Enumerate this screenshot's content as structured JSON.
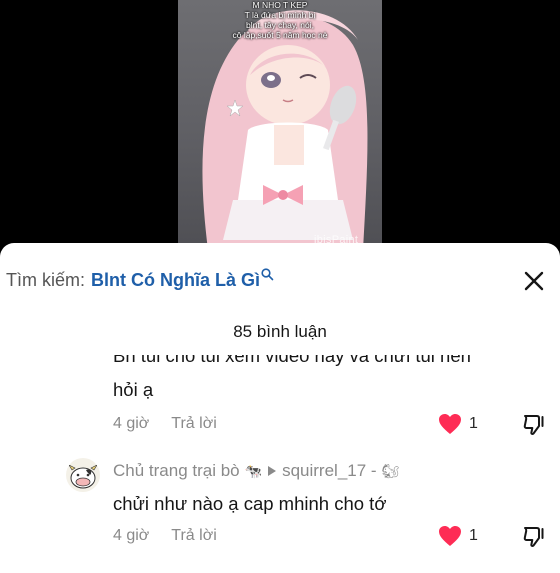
{
  "video": {
    "caption_lines": [
      "M NHO T KEP",
      "T là đứa bị mình bị",
      "blnt, tây chay, nói,",
      "cô lập,suốt 5 năm học nè"
    ],
    "watermark": "ibisPaint"
  },
  "search": {
    "prefix": "Tìm kiếm:",
    "query": "Blnt Có Nghĩa Là Gì"
  },
  "comments_header": {
    "count_label": "85 bình luận"
  },
  "comments": [
    {
      "text_partial": "Bn tui cho tui xem video này và chửi tui nên",
      "text_line2": "hỏi ạ",
      "time": "4 giờ",
      "reply_label": "Trả lời",
      "likes": "1"
    },
    {
      "author": "Chủ trang trại bò",
      "reply_to": "squirrel_17 -",
      "text": "chửi như nào ạ cap mhinh cho tớ",
      "time": "4 giờ",
      "reply_label": "Trả lời",
      "likes": "1"
    }
  ],
  "colors": {
    "like": "#fe2c55",
    "search_query": "#1f5fa9",
    "muted": "#8a8a8a"
  },
  "icons": {
    "search": "search-icon",
    "close": "close-icon",
    "like": "heart-icon",
    "dislike": "thumbs-down-icon",
    "cow": "cow-icon",
    "reply_arrow": "play-arrow-icon",
    "squirrel": "squirrel-icon"
  }
}
